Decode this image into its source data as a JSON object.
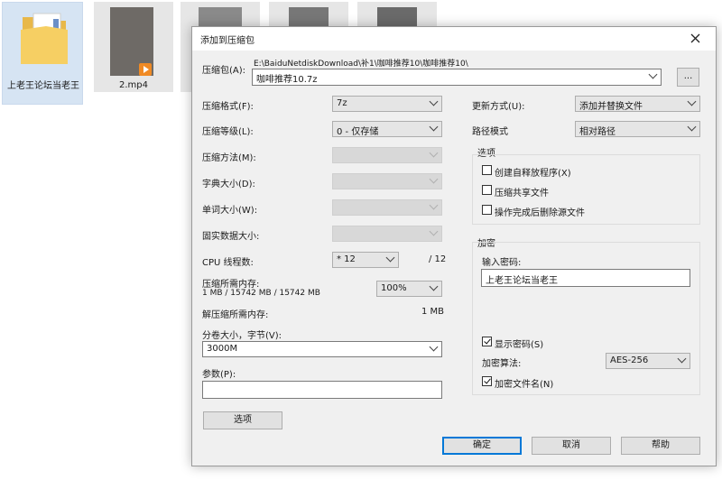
{
  "desktop": {
    "items": [
      {
        "label": "上老王论坛当老王"
      },
      {
        "label": "2.mp4"
      }
    ]
  },
  "dialog": {
    "title": "添加到压缩包",
    "archive": {
      "label": "压缩包(A):",
      "path": "E:\\BaiduNetdiskDownload\\补1\\咖啡推荐10\\咖啡推荐10\\",
      "name": "咖啡推荐10.7z",
      "browse": "..."
    },
    "left": {
      "format": {
        "label": "压缩格式(F):",
        "value": "7z"
      },
      "level": {
        "label": "压缩等级(L):",
        "value": "0 - 仅存储"
      },
      "method": {
        "label": "压缩方法(M):"
      },
      "dict": {
        "label": "字典大小(D):"
      },
      "word": {
        "label": "单词大小(W):"
      },
      "solid": {
        "label": "固实数据大小:"
      },
      "cpu": {
        "label": "CPU 线程数:",
        "value": "* 12",
        "max": "/ 12"
      },
      "mem_comp": {
        "label": "压缩所需内存:",
        "detail": "1 MB / 15742 MB / 15742 MB",
        "value": "100%"
      },
      "mem_decomp": {
        "label": "解压缩所需内存:",
        "value": "1 MB"
      },
      "volume": {
        "label": "分卷大小，字节(V):",
        "value": "3000M"
      },
      "params": {
        "label": "参数(P):",
        "value": ""
      },
      "options_btn": "选项"
    },
    "right": {
      "update": {
        "label": "更新方式(U):",
        "value": "添加并替换文件"
      },
      "pathmode": {
        "label": "路径模式",
        "value": "相对路径"
      },
      "options": {
        "title": "选项",
        "sfx": "创建自释放程序(X)",
        "shared": "压缩共享文件",
        "delete": "操作完成后删除源文件"
      },
      "encrypt": {
        "title": "加密",
        "pw_label": "输入密码:",
        "pw_value": "上老王论坛当老王",
        "show_pw": "显示密码(S)",
        "method_label": "加密算法:",
        "method_value": "AES-256",
        "encrypt_names": "加密文件名(N)"
      }
    },
    "buttons": {
      "ok": "确定",
      "cancel": "取消",
      "help": "帮助"
    }
  }
}
